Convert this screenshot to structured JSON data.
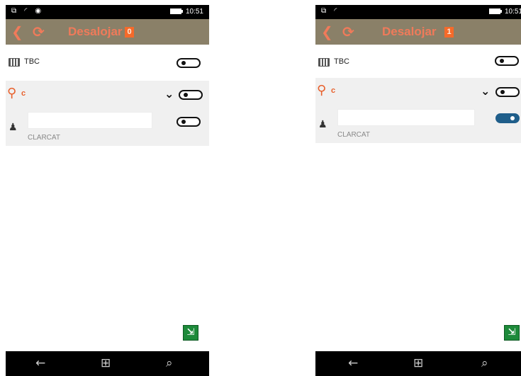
{
  "screens": [
    {
      "status_time": "10:51",
      "status_icons": "⧉ ◜ ◉",
      "title": "Desalojar",
      "count": "0",
      "rows": {
        "tbc_label": "TBC",
        "tbc_toggle_on": false,
        "location_label": "c",
        "location_toggle_on": false,
        "person_input_value": "",
        "person_label": "CLARCAT",
        "person_toggle_on": false
      }
    },
    {
      "status_time": "10:51",
      "status_icons": "⧉ ◜",
      "title": "Desalojar",
      "count": "1",
      "rows": {
        "tbc_label": "TBC",
        "tbc_toggle_on": false,
        "location_label": "c",
        "location_toggle_on": false,
        "person_input_value": "",
        "person_label": "CLARCAT",
        "person_toggle_on": true
      }
    }
  ],
  "icons": {
    "back": "back-chevron-icon",
    "sync": "sync-icon",
    "tbc": "keyboard-icon",
    "location": "map-pin-icon",
    "person": "person-icon",
    "chevron": "chevron-down-icon",
    "exit": "exit-door-icon",
    "nav_back": "nav-back-icon",
    "nav_home": "windows-logo-icon",
    "nav_search": "search-icon"
  },
  "colors": {
    "appbar_bg": "#8a8068",
    "accent_orange": "#f07a5a",
    "count_badge": "#f56a2a",
    "toggle_on": "#1f5e8a",
    "exit_green": "#1d8a3a"
  }
}
